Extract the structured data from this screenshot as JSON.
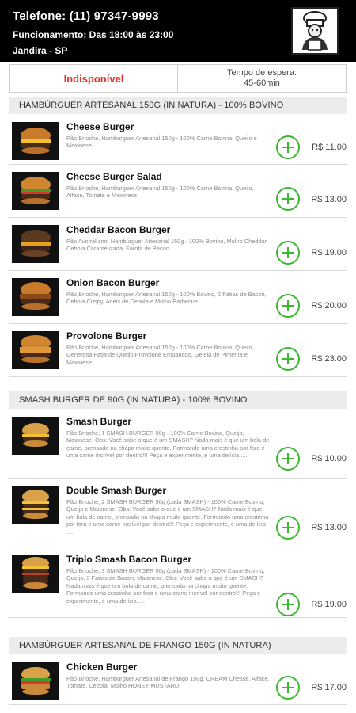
{
  "header": {
    "phone": "Telefone: (11) 97347-9993",
    "hours": "Funcionamento: Das 18:00 às 23:00",
    "city": "Jandira - SP"
  },
  "status": {
    "availability": "Indisponível",
    "wait_label": "Tempo de espera:",
    "wait_value": "45-60min"
  },
  "sections": [
    {
      "title": "HAMBÚRGUER ARTESANAL 150G (IN NATURA) - 100% BOVINO",
      "items": [
        {
          "name": "Cheese Burger",
          "desc": "Pão Brioche, Hambúrguer Artesanal 150g - 100% Carne Bovina, Queijo e Maionese",
          "price": "R$ 11.00"
        },
        {
          "name": "Cheese Burger Salad",
          "desc": "Pão Brioche, Hambúrguer Artesanal 150g - 100% Carne Bovina, Queijo, Alface, Tomate e Maionese",
          "price": "R$ 13.00"
        },
        {
          "name": "Cheddar Bacon Burger",
          "desc": "Pão Australiano, Hambúrguer Artesanal 150g - 100% Bovino, Molho Cheddar, Cebola Caramelizada, Farofa de Bacon",
          "price": "R$ 19.00"
        },
        {
          "name": "Onion Bacon Burger",
          "desc": "Pão Brioche, Hambúrguer Artesanal 150g - 100% Bovino, 2 Fatias de Bacon, Cebola Crispy, Anéis de Cebola e Molho Barbecue",
          "price": "R$ 20.00"
        },
        {
          "name": "Provolone Burger",
          "desc": "Pão Brioche, Hambúrguer Artesanal 150g - 100% Carne Bovina, Queijo, Generosa Fatia de Queijo Provolone Empanado, Geleia de Pimenta e Maionese",
          "price": "R$ 23.00"
        }
      ]
    },
    {
      "title": "SMASH BURGER DE 90G (IN NATURA) - 100% BOVINO",
      "items": [
        {
          "name": "Smash Burger",
          "desc": "Pão Brioche, 1 SMASH BURGER 90g - 100% Carne Bovina, Queijo, Maionese. Obs: Você sabe o que é um SMASH? Nada mais é que um bola de carne, prensada na chapa muito quente. Formando uma crostinha por fora e uma carne incrível por dentro!!! Peça e experimente, é uma delícia ....",
          "price": "R$ 10.00"
        },
        {
          "name": "Double Smash Burger",
          "desc": "Pão Brioche, 2 SMASH BURGER 90g (cada SMASH) - 100% Carne Bovino, Queijo e Maionese. Obs: Você sabe o que é um SMASH? Nada mais é que um bola de carne, prensada na chapa muito quente. Formando uma crostinha por fora e uma carne incrível por dentro!!! Peça e experimente, é uma delícia ....",
          "price": "R$ 13.00"
        },
        {
          "name": "Triplo Smash Bacon Burger",
          "desc": "Pão Brioche, 3 SMASH BURGER 90g (cada SMASH) - 100% Carne Bovino, Queijo, 3 Fatias de Bacon, Maionese. Obs: Você sabe o que é um SMASH? Nada mais é que um bola de carne, prensada na chapa muito quente. Formando uma crostinha por fora e uma carne incrível por dentro!!! Peça e experimente, é uma delícia ....",
          "price": "R$ 19.00"
        }
      ]
    },
    {
      "title": "HAMBÚRGUER ARTESANAL DE FRANGO 150G (IN NATURA)",
      "items": [
        {
          "name": "Chicken Burger",
          "desc": "Pão Brioche, Hambúrguer Artesanal de Frango 150g, CREAM Chesse, Alface, Tomate, Cebola, Molho HONEY MUSTARD",
          "price": "R$ 17.00"
        }
      ]
    }
  ],
  "colors": {
    "accent": "#3cb82f",
    "unavailable": "#e0302b",
    "header_bg": "#000000"
  }
}
